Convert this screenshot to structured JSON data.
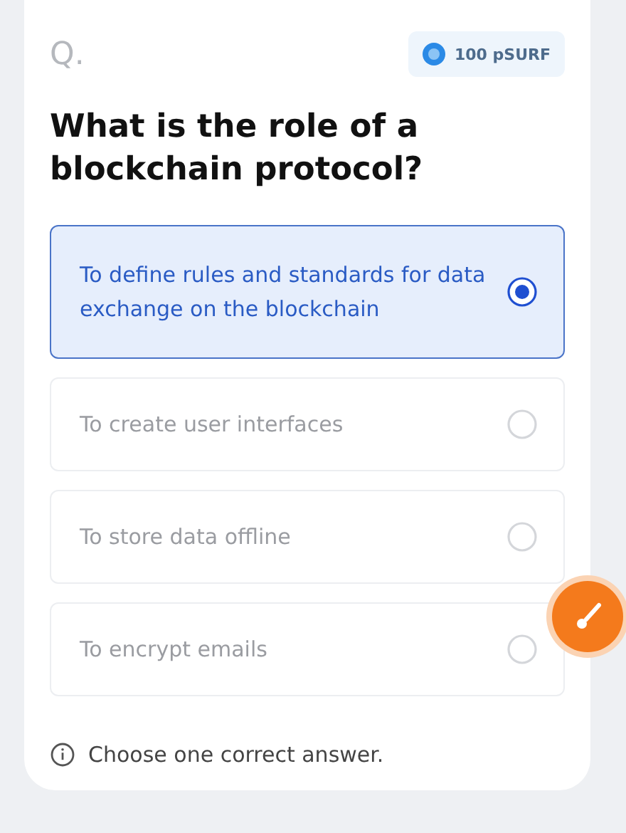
{
  "question_label": "Q.",
  "reward": {
    "label": "100 pSURF"
  },
  "question": "What is the role of a blockchain protocol?",
  "options": [
    {
      "text": "To define rules and standards for data exchange on the blockchain",
      "selected": true
    },
    {
      "text": "To create user interfaces",
      "selected": false
    },
    {
      "text": "To store data offline",
      "selected": false
    },
    {
      "text": "To encrypt emails",
      "selected": false
    }
  ],
  "hint": "Choose one correct answer."
}
